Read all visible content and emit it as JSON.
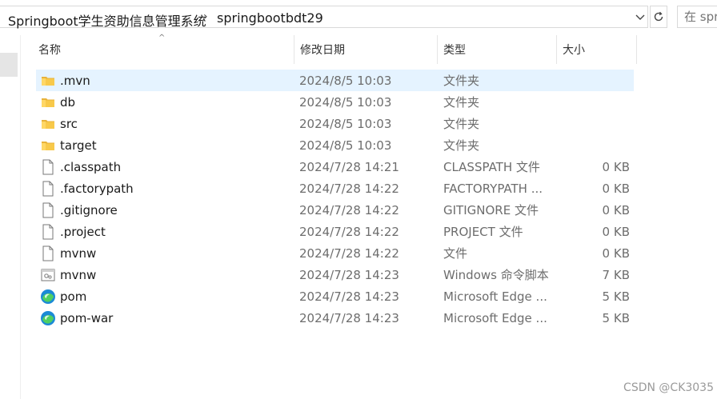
{
  "address": {
    "breadcrumbs": [
      "Springboot学生资助信息管理系统",
      "springbootbdt29"
    ],
    "search_placeholder": "在 spr"
  },
  "columns": {
    "name": "名称",
    "date": "修改日期",
    "type": "类型",
    "size": "大小"
  },
  "files": [
    {
      "name": ".mvn",
      "date": "2024/8/5 10:03",
      "type": "文件夹",
      "size": "",
      "icon": "folder-icon"
    },
    {
      "name": "db",
      "date": "2024/8/5 10:03",
      "type": "文件夹",
      "size": "",
      "icon": "folder-icon"
    },
    {
      "name": "src",
      "date": "2024/8/5 10:03",
      "type": "文件夹",
      "size": "",
      "icon": "folder-icon"
    },
    {
      "name": "target",
      "date": "2024/8/5 10:03",
      "type": "文件夹",
      "size": "",
      "icon": "folder-icon"
    },
    {
      "name": ".classpath",
      "date": "2024/7/28 14:21",
      "type": "CLASSPATH 文件",
      "size": "0 KB",
      "icon": "file-icon"
    },
    {
      "name": ".factorypath",
      "date": "2024/7/28 14:22",
      "type": "FACTORYPATH ...",
      "size": "0 KB",
      "icon": "file-icon"
    },
    {
      "name": ".gitignore",
      "date": "2024/7/28 14:22",
      "type": "GITIGNORE 文件",
      "size": "0 KB",
      "icon": "file-icon"
    },
    {
      "name": ".project",
      "date": "2024/7/28 14:22",
      "type": "PROJECT 文件",
      "size": "0 KB",
      "icon": "file-icon"
    },
    {
      "name": "mvnw",
      "date": "2024/7/28 14:22",
      "type": "文件",
      "size": "0 KB",
      "icon": "file-icon"
    },
    {
      "name": "mvnw",
      "date": "2024/7/28 14:23",
      "type": "Windows 命令脚本",
      "size": "7 KB",
      "icon": "script-icon"
    },
    {
      "name": "pom",
      "date": "2024/7/28 14:23",
      "type": "Microsoft Edge ...",
      "size": "5 KB",
      "icon": "edge-icon"
    },
    {
      "name": "pom-war",
      "date": "2024/7/28 14:23",
      "type": "Microsoft Edge ...",
      "size": "5 KB",
      "icon": "edge-icon"
    }
  ],
  "selected_index": 0,
  "watermark": "CSDN @CK3035",
  "colors": {
    "selection": "#e5f3ff",
    "folder": "#f8c94a",
    "edge": "#1b8ad6"
  }
}
